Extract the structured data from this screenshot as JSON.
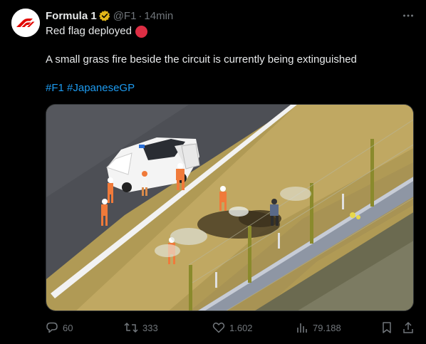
{
  "user": {
    "name": "Formula 1",
    "handle": "@F1",
    "separator": "·",
    "time": "14min",
    "avatar_icon": "f1-logo-icon",
    "verified_icon": "gold-verified-badge-icon"
  },
  "tweet": {
    "line1": "Red flag deployed",
    "line1_emoji": "red-circle-icon",
    "line2": "A small grass fire beside the circuit is currently being extinguished",
    "hashtags": [
      "#F1",
      "#JapaneseGP"
    ]
  },
  "media": {
    "icon": "photo-track-marshals-grass-fire"
  },
  "actions": {
    "replies": "60",
    "reposts": "333",
    "likes": "1.602",
    "views": "79.188"
  },
  "colors": {
    "background": "#000000",
    "text": "#e7e9ea",
    "muted": "#71767b",
    "link": "#1d9bf0",
    "brand_red": "#e10600",
    "red_circle": "#dd2e44",
    "verified_gold": "#e2b719"
  }
}
